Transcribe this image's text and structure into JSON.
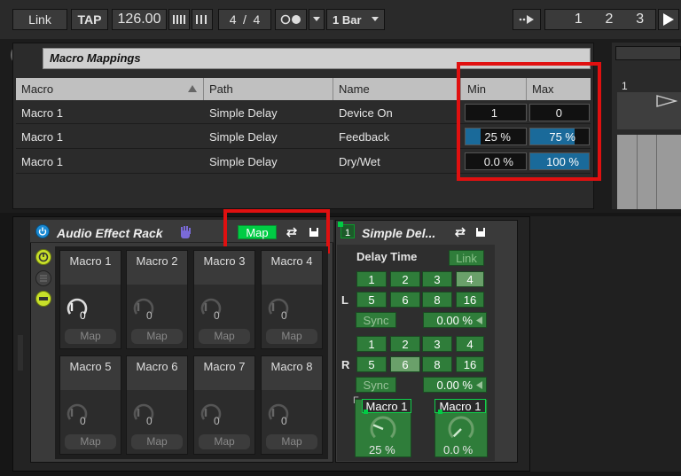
{
  "transport": {
    "link": "Link",
    "tap": "TAP",
    "tempo": "126.00",
    "time_sig_num": "4",
    "time_sig_den": "4",
    "slash": "/",
    "quantize": "1 Bar",
    "position": [
      "1",
      "2",
      "3"
    ]
  },
  "mappings": {
    "title": "Macro Mappings",
    "columns": [
      "Macro",
      "Path",
      "Name",
      "Min",
      "Max"
    ],
    "rows": [
      {
        "macro": "Macro 1",
        "path": "Simple Delay",
        "name": "Device On",
        "min": "1",
        "max": "0",
        "min_fill": 0,
        "max_fill": 0
      },
      {
        "macro": "Macro 1",
        "path": "Simple Delay",
        "name": "Feedback",
        "min": "25 %",
        "max": "75 %",
        "min_fill": 0.25,
        "max_fill": 0.75
      },
      {
        "macro": "Macro 1",
        "path": "Simple Delay",
        "name": "Dry/Wet",
        "min": "0.0 %",
        "max": "100 %",
        "min_fill": 0,
        "max_fill": 1
      }
    ]
  },
  "clip": {
    "label": "1"
  },
  "rack": {
    "title": "Audio Effect Rack",
    "map_label": "Map",
    "macros": [
      {
        "name": "Macro 1",
        "value": "0",
        "map": "Map"
      },
      {
        "name": "Macro 2",
        "value": "0",
        "map": "Map"
      },
      {
        "name": "Macro 3",
        "value": "0",
        "map": "Map"
      },
      {
        "name": "Macro 4",
        "value": "0",
        "map": "Map"
      },
      {
        "name": "Macro 5",
        "value": "0",
        "map": "Map"
      },
      {
        "name": "Macro 6",
        "value": "0",
        "map": "Map"
      },
      {
        "name": "Macro 7",
        "value": "0",
        "map": "Map"
      },
      {
        "name": "Macro 8",
        "value": "0",
        "map": "Map"
      }
    ]
  },
  "delay": {
    "title": "Simple Del...",
    "delay_time": "Delay Time",
    "link": "Link",
    "left": "L",
    "right": "R",
    "left_row1": [
      "1",
      "2",
      "3",
      "4"
    ],
    "left_row2": [
      "5",
      "6",
      "8",
      "16"
    ],
    "left_selected": "4",
    "right_row1": [
      "1",
      "2",
      "3",
      "4"
    ],
    "right_row2": [
      "5",
      "6",
      "8",
      "16"
    ],
    "right_selected": "6",
    "sync": "Sync",
    "left_offset": "0.00 %",
    "right_offset": "0.00 %",
    "feedback_tag": "Macro 1",
    "feedback_value": "25 %",
    "feedback_level": 0.25,
    "drywet_tag": "Macro 1",
    "drywet_value": "0.0 %",
    "drywet_level": 0.0,
    "f_letter": "F"
  },
  "colors": {
    "accent_green": "#00cc44",
    "highlight_red": "#e01010",
    "cell_blue": "#1a6a9a",
    "device_green": "#2f7d3a"
  }
}
